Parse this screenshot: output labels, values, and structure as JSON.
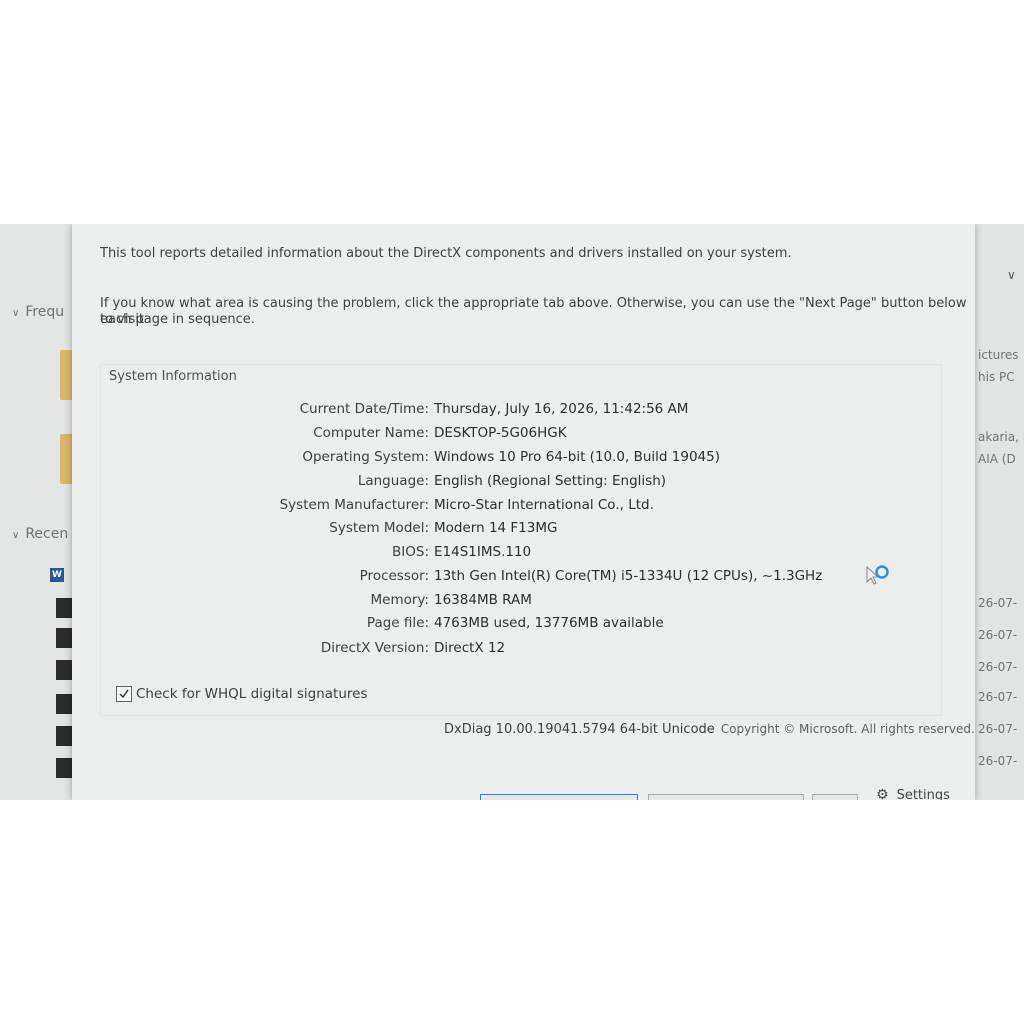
{
  "background_left": {
    "frequent_label": "Frequ",
    "recent_label": "Recen",
    "word_badge": "W"
  },
  "background_right": {
    "lines": [
      "ictures",
      "his PC",
      "akaria, I",
      "AIA (D"
    ],
    "dates": [
      "26-07-",
      "26-07-",
      "26-07-",
      "26-07-",
      "26-07-",
      "26-07-"
    ]
  },
  "dxdiag": {
    "intro_line1": "This tool reports detailed information about the DirectX components and drivers installed on your system.",
    "intro_line2": "If you know what area is causing the problem, click the appropriate tab above.  Otherwise, you can use the \"Next Page\" button below to visit",
    "intro_line3": "each page in sequence.",
    "group_title": "System Information",
    "rows": [
      {
        "label": "Current Date/Time:",
        "value": "Thursday, July 16, 2026, 11:42:56 AM"
      },
      {
        "label": "Computer Name:",
        "value": "DESKTOP-5G06HGK"
      },
      {
        "label": "Operating System:",
        "value": "Windows 10 Pro 64-bit (10.0, Build 19045)"
      },
      {
        "label": "Language:",
        "value": "English (Regional Setting: English)"
      },
      {
        "label": "System Manufacturer:",
        "value": "Micro-Star International Co., Ltd."
      },
      {
        "label": "System Model:",
        "value": "Modern 14 F13MG"
      },
      {
        "label": "BIOS:",
        "value": "E14S1IMS.110"
      },
      {
        "label": "Processor:",
        "value": "13th Gen Intel(R) Core(TM) i5-1334U (12 CPUs), ~1.3GHz"
      },
      {
        "label": "Memory:",
        "value": "16384MB RAM"
      },
      {
        "label": "Page file:",
        "value": "4763MB used, 13776MB available"
      },
      {
        "label": "DirectX Version:",
        "value": "DirectX 12"
      }
    ],
    "whql_label": "Check for WHQL digital signatures",
    "whql_checked": true,
    "version_text": "DxDiag 10.00.19041.5794 64-bit Unicode",
    "copyright_text": "Copyright © Microsoft. All rights reserved."
  },
  "taskbar": {
    "settings_label": "Settings"
  }
}
